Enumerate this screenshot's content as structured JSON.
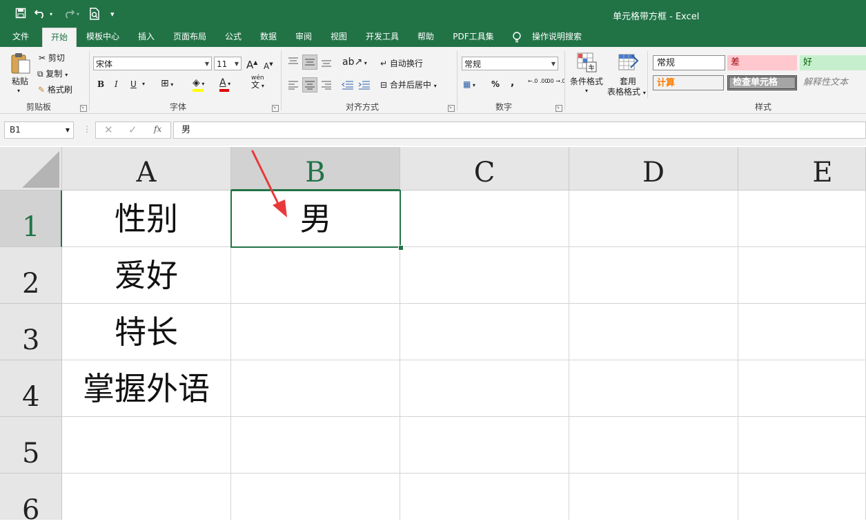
{
  "window": {
    "title": "单元格带方框  -  Excel",
    "qat": {
      "save_icon": "save-icon",
      "undo_icon": "undo-icon",
      "redo_icon": "redo-icon",
      "preview_icon": "print-preview-icon",
      "customize_icon": "customize-qat-icon"
    }
  },
  "tabs": [
    {
      "label": "文件"
    },
    {
      "label": "开始"
    },
    {
      "label": "模板中心"
    },
    {
      "label": "插入"
    },
    {
      "label": "页面布局"
    },
    {
      "label": "公式"
    },
    {
      "label": "数据"
    },
    {
      "label": "审阅"
    },
    {
      "label": "视图"
    },
    {
      "label": "开发工具"
    },
    {
      "label": "帮助"
    },
    {
      "label": "PDF工具集"
    },
    {
      "label": "操作说明搜索"
    }
  ],
  "ribbon": {
    "clipboard": {
      "paste": "粘贴",
      "cut": "剪切",
      "copy": "复制",
      "format_painter": "格式刷",
      "label": "剪贴板"
    },
    "font": {
      "name": "宋体",
      "size": "11",
      "bold": "B",
      "italic": "I",
      "underline": "U",
      "grow": "A",
      "shrink": "A",
      "phonetic": "wén",
      "phonetic_char": "文",
      "label": "字体",
      "fill_color": "#ffff00",
      "font_color": "#e00000"
    },
    "alignment": {
      "wrap": "自动换行",
      "merge": "合并后居中",
      "label": "对齐方式"
    },
    "number": {
      "format": "常规",
      "percent": "%",
      "comma": ",",
      "inc_decimal": "←.0 .00",
      "dec_decimal": ".00 →.0",
      "label": "数字"
    },
    "styles": {
      "conditional": "条件格式",
      "table_1": "套用",
      "table_2": "表格格式",
      "normal": "常规",
      "bad": "差",
      "good": "好",
      "calc": "计算",
      "check": "检查单元格",
      "explanatory": "解释性文本",
      "label": "样式",
      "bad_bg": "#ffc7ce",
      "bad_fg": "#9c0006",
      "good_bg": "#c6efce",
      "good_fg": "#006100",
      "calc_fg": "#fa7d00",
      "check_bg": "#a5a5a5"
    }
  },
  "formula_bar": {
    "name_box": "B1",
    "fx": "fx",
    "content": "男"
  },
  "sheet": {
    "columns": [
      "A",
      "B",
      "C",
      "D",
      "E"
    ],
    "rows": [
      "1",
      "2",
      "3",
      "4",
      "5",
      "6"
    ],
    "cells": {
      "A1": "性别",
      "A2": "爱好",
      "A3": "特长",
      "A4": "掌握外语",
      "B1": "男"
    },
    "selected_cell": "B1",
    "accent": "#217346",
    "arrow_color": "#e8393a"
  }
}
